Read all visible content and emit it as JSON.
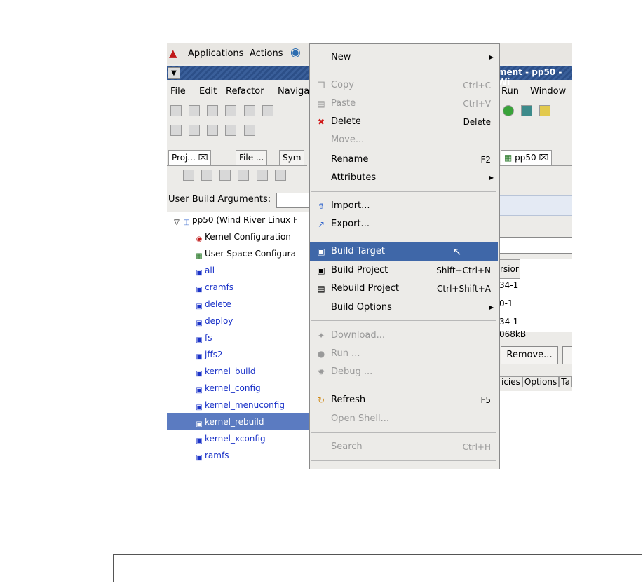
{
  "top_panel": {
    "applications": "Applications",
    "actions": "Actions"
  },
  "window_title": "ment - pp50 - Wi",
  "menubar": {
    "file": "File",
    "edit": "Edit",
    "refactor": "Refactor",
    "navigate": "Naviga",
    "run": "Run",
    "window": "Window"
  },
  "tabs": {
    "project": "Proj...",
    "file": "File ...",
    "sym": "Sym",
    "editor": "pp50"
  },
  "user_build_args": "User Build Arguments:",
  "tree": {
    "root": "pp50 (Wind River Linux F",
    "items": [
      "Kernel Configuration",
      "User Space Configura",
      "all",
      "cramfs",
      "delete",
      "deploy",
      "fs",
      "jffs2",
      "kernel_build",
      "kernel_config",
      "kernel_menuconfig",
      "kernel_rebuild",
      "kernel_xconfig",
      "ramfs"
    ]
  },
  "context_menu": {
    "new": "New",
    "copy": "Copy",
    "copy_acc": "Ctrl+C",
    "paste": "Paste",
    "paste_acc": "Ctrl+V",
    "delete": "Delete",
    "delete_acc": "Delete",
    "move": "Move...",
    "rename": "Rename",
    "rename_acc": "F2",
    "attributes": "Attributes",
    "import": "Import...",
    "export": "Export...",
    "build_target": "Build Target",
    "build_project": "Build Project",
    "build_project_acc": "Shift+Ctrl+N",
    "rebuild_project": "Rebuild Project",
    "rebuild_project_acc": "Ctrl+Shift+A",
    "build_options": "Build Options",
    "download": "Download...",
    "run": "Run ...",
    "debug": "Debug ...",
    "refresh": "Refresh",
    "refresh_acc": "F5",
    "open_shell": "Open Shell...",
    "search": "Search",
    "search_acc": "Ctrl+H"
  },
  "right_pane": {
    "col_header": "rsior",
    "rows": [
      "34-1",
      "0-1",
      "34-1",
      "068kB"
    ],
    "remove_button": "Remove...",
    "tabs": [
      "icies",
      "Options",
      "Ta"
    ]
  }
}
